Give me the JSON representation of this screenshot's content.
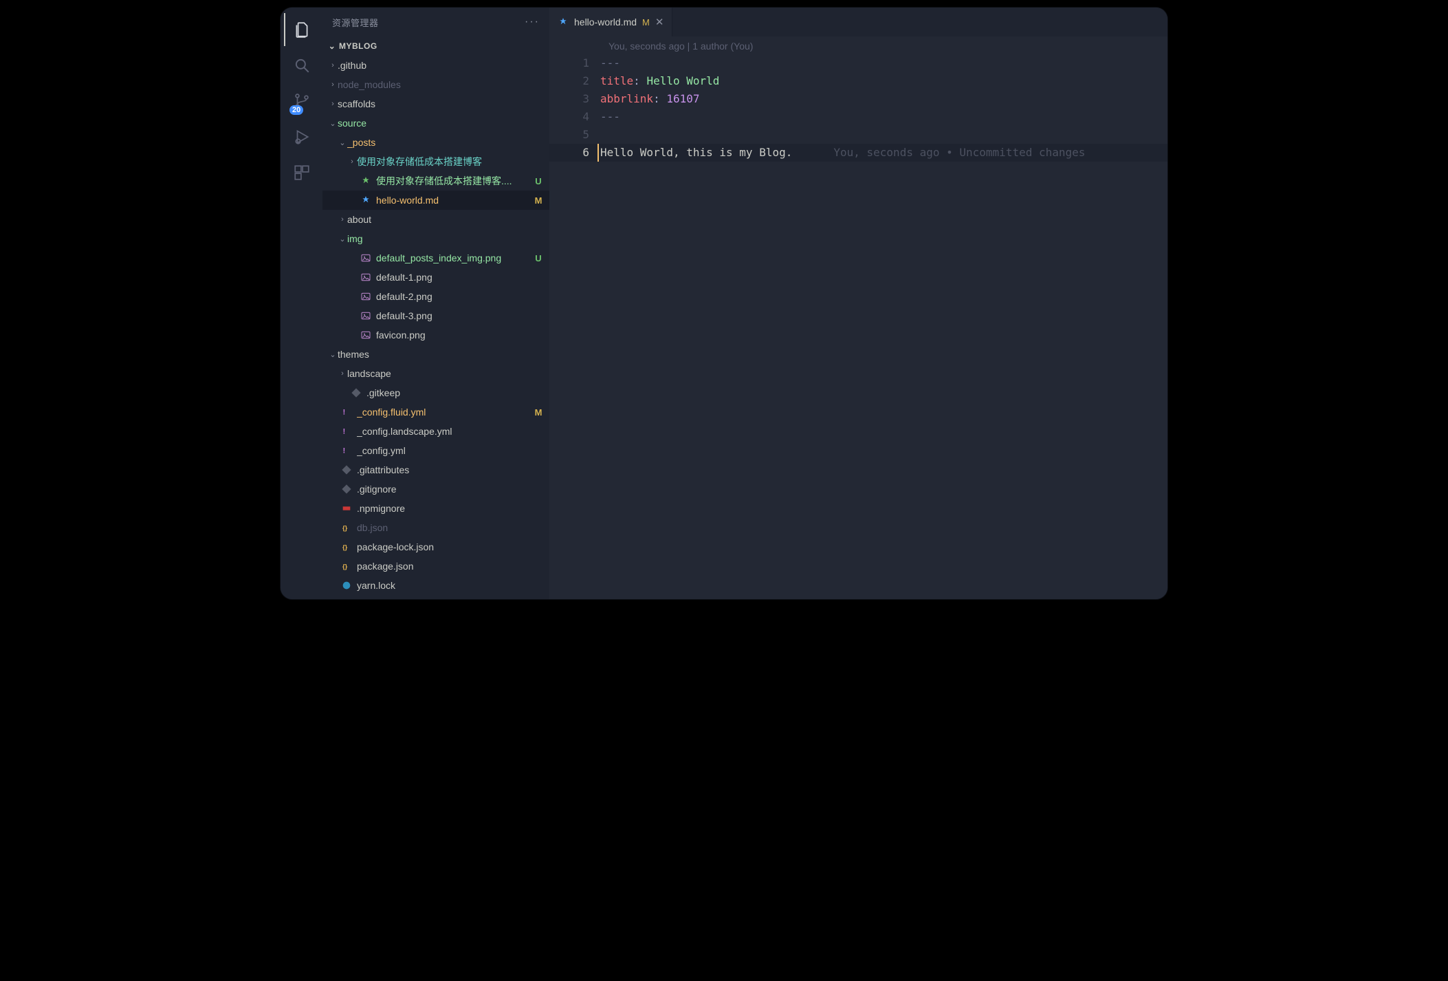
{
  "activity": {
    "scm_badge": "20"
  },
  "sidebar": {
    "title": "资源管理器",
    "more": "···",
    "section": "MYBLOG",
    "items": [
      {
        "kind": "folder",
        "label": ".github",
        "indent": 0,
        "expanded": false,
        "color": "plain"
      },
      {
        "kind": "folder",
        "label": "node_modules",
        "indent": 0,
        "expanded": false,
        "color": "dim"
      },
      {
        "kind": "folder",
        "label": "scaffolds",
        "indent": 0,
        "expanded": false,
        "color": "plain"
      },
      {
        "kind": "folder",
        "label": "source",
        "indent": 0,
        "expanded": true,
        "color": "green",
        "dot": "green"
      },
      {
        "kind": "folder",
        "label": "_posts",
        "indent": 1,
        "expanded": true,
        "color": "orange",
        "dot": "olive"
      },
      {
        "kind": "folder",
        "label": "使用对象存储低成本搭建博客",
        "indent": 2,
        "expanded": false,
        "color": "teal"
      },
      {
        "kind": "file",
        "label": "使用对象存储低成本搭建博客....",
        "indent": 2,
        "icon": "md-green",
        "color": "green",
        "status": "U"
      },
      {
        "kind": "file",
        "label": "hello-world.md",
        "indent": 2,
        "icon": "md-blue",
        "color": "orange",
        "status": "M",
        "selected": true
      },
      {
        "kind": "folder",
        "label": "about",
        "indent": 1,
        "expanded": false,
        "color": "plain"
      },
      {
        "kind": "folder",
        "label": "img",
        "indent": 1,
        "expanded": true,
        "color": "green",
        "dot": "green"
      },
      {
        "kind": "file",
        "label": "default_posts_index_img.png",
        "indent": 2,
        "icon": "img",
        "color": "green",
        "status": "U"
      },
      {
        "kind": "file",
        "label": "default-1.png",
        "indent": 2,
        "icon": "img",
        "color": "plain"
      },
      {
        "kind": "file",
        "label": "default-2.png",
        "indent": 2,
        "icon": "img",
        "color": "plain"
      },
      {
        "kind": "file",
        "label": "default-3.png",
        "indent": 2,
        "icon": "img",
        "color": "plain"
      },
      {
        "kind": "file",
        "label": "favicon.png",
        "indent": 2,
        "icon": "img",
        "color": "plain"
      },
      {
        "kind": "folder",
        "label": "themes",
        "indent": 0,
        "expanded": true,
        "color": "plain"
      },
      {
        "kind": "folder",
        "label": "landscape",
        "indent": 1,
        "expanded": false,
        "color": "plain"
      },
      {
        "kind": "file",
        "label": ".gitkeep",
        "indent": 1,
        "icon": "git",
        "color": "plain"
      },
      {
        "kind": "file",
        "label": "_config.fluid.yml",
        "indent": 0,
        "icon": "yml",
        "color": "orange",
        "status": "M"
      },
      {
        "kind": "file",
        "label": "_config.landscape.yml",
        "indent": 0,
        "icon": "yml",
        "color": "plain"
      },
      {
        "kind": "file",
        "label": "_config.yml",
        "indent": 0,
        "icon": "yml",
        "color": "plain"
      },
      {
        "kind": "file",
        "label": ".gitattributes",
        "indent": 0,
        "icon": "git",
        "color": "plain"
      },
      {
        "kind": "file",
        "label": ".gitignore",
        "indent": 0,
        "icon": "git",
        "color": "plain"
      },
      {
        "kind": "file",
        "label": ".npmignore",
        "indent": 0,
        "icon": "npm",
        "color": "plain"
      },
      {
        "kind": "file",
        "label": "db.json",
        "indent": 0,
        "icon": "json",
        "color": "dim"
      },
      {
        "kind": "file",
        "label": "package-lock.json",
        "indent": 0,
        "icon": "json",
        "color": "plain"
      },
      {
        "kind": "file",
        "label": "package.json",
        "indent": 0,
        "icon": "json",
        "color": "plain"
      },
      {
        "kind": "file",
        "label": "yarn.lock",
        "indent": 0,
        "icon": "yarn",
        "color": "plain"
      }
    ]
  },
  "tab": {
    "name": "hello-world.md",
    "status": "M"
  },
  "blame": "You, seconds ago | 1 author (You)",
  "code": {
    "lines": [
      {
        "n": "1",
        "segments": [
          {
            "t": "---",
            "c": "dash"
          }
        ]
      },
      {
        "n": "2",
        "segments": [
          {
            "t": "title",
            "c": "red"
          },
          {
            "t": ": ",
            "c": "punct"
          },
          {
            "t": "Hello World",
            "c": "str"
          }
        ]
      },
      {
        "n": "3",
        "segments": [
          {
            "t": "abbrlink",
            "c": "red"
          },
          {
            "t": ": ",
            "c": "punct"
          },
          {
            "t": "16107",
            "c": "num"
          }
        ]
      },
      {
        "n": "4",
        "segments": [
          {
            "t": "---",
            "c": "dash"
          }
        ]
      },
      {
        "n": "5",
        "segments": []
      },
      {
        "n": "6",
        "active": true,
        "segments": [
          {
            "t": "Hello World, this is my Blog.",
            "c": "plain"
          }
        ],
        "ghost": "You, seconds ago • Uncommitted changes"
      }
    ]
  }
}
